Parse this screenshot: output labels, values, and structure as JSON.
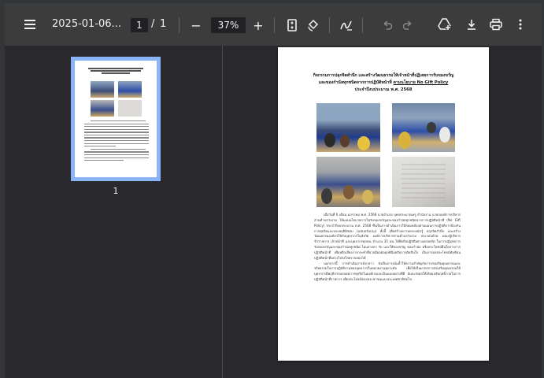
{
  "toolbar": {
    "menu_icon": "hamburger-menu-icon",
    "file_name": "2025-01-06...",
    "page_current": "1",
    "page_separator": "/",
    "page_total": "1",
    "zoom_out_label": "−",
    "zoom_value": "37%",
    "zoom_in_label": "+",
    "icons": [
      "fit-page-icon",
      "rotate-icon",
      "annotate-pen-icon",
      "undo-icon",
      "redo-icon",
      "save-to-drive-icon",
      "download-icon",
      "print-icon",
      "more-options-icon"
    ]
  },
  "sidebar": {
    "thumbnail_label": "1"
  },
  "document": {
    "title_line1": "กิจกรรมการปลุกจิตสำนึก และสร้างวัฒนธรรมให้เจ้าหน้าที่ปฏิเสธการรับของขวัญ",
    "title_line2_prefix": "และของกำนัลทุกชนิดจากการปฏิบัติหน้าที่",
    "title_line2_underlined": "ตามนโยบาย No Gift Policy",
    "title_line3": "ประจำปีงบประมาณ พ.ศ. 2568",
    "paragraph1": "เมื่อวันที่ 6 เดือน มกราคม พ.ศ. 2568 นายอำเภอ บุคลประมาณครู สำนักงาน นายกองค์การบริหารส่วนตำบลวังงาม ได้มอบนโยบายการไม่รับของขวัญและของกำนัลทุกชนิดจากการปฏิบัติหน้าที่ (No Gift Policy) ประจำปีงบประมาณ พ.ศ. 2568 ซึ่งเป็นการดำเนินการให้สอดคล้องตามแผนการปฏิบัติการป้องกันการทุจริตและประพฤติมิชอบ (ฉบับปรับปรุง) ทั้งนี้ เพื่อสร้างความตระหนักรู้ ปลุกจิตสำนึก และสร้างวัฒนธรรมองค์กรให้กับบุคลากรในสังกัด องค์การบริหารส่วนตำบลวังงาม ประกอบด้วย คณะผู้บริหาร ข้าราชการ เจ้าหน้าที่ และบุคลากรทุกคน จำนวน 35 คน ได้ยึดถือปฏิบัติอย่างเคร่งครัด ในการปฏิเสธการรับของขวัญและของกำนัลทุกชนิด ไม่แสวงหา รับ และให้ของขวัญ ของกำนัล หรือประโยชน์อื่นใดจากการปฏิบัติหน้าที่ เพื่อหลีกเลี่ยงการกระทำที่อาจมีผลต่อดุลพินิจหรือการตัดสินใจ เป็นการผลประโยชน์ทับซ้อนปฏิบัติหน้าที่อย่างโปร่งใสตรวจสอบได้",
    "paragraph2": "นอกจากนี้ การดำเนินการดังกล่าว ยังเป็นการเน้นย้ำให้ความสำคัญกับการส่งเสริมคุณธรรมและจริยธรรมในการปฏิบัติงานของบุคลากรในหน่วยงานทุกระดับ เพื่อให้เป็นมาตรการส่งเสริมคุณธรรมให้บุคลากรมีพฤติกรรมปลอดการทุจริตในองค์กรและเป็นแบบอย่างที่ดี อันจะส่งผลให้เกิดผลสัมฤทธิ์ภายในการปฏิบัติหน้าที่ราชการ เพื่อประโยชน์ของประชาชนและประเทศชาติต่อไป"
  },
  "colors": {
    "toolbar_bg": "#3c3c3c",
    "viewer_bg": "#2a2a2e",
    "thumbnail_highlight": "#8ab4f8"
  }
}
